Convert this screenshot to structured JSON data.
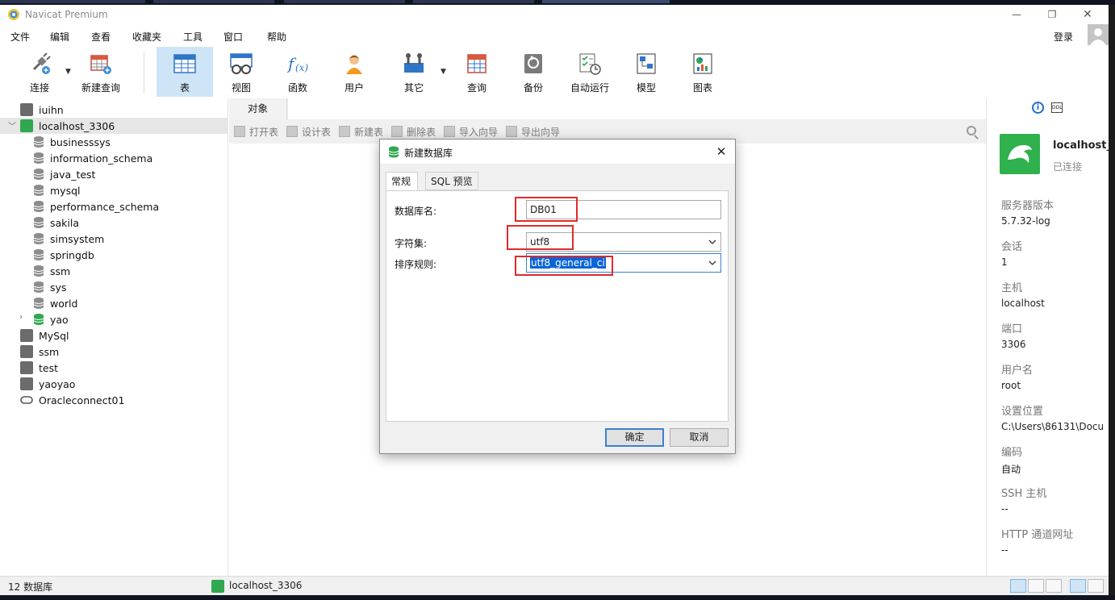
{
  "app": {
    "title": "Navicat Premium"
  },
  "menu": {
    "items": [
      "文件",
      "编辑",
      "查看",
      "收藏夹",
      "工具",
      "窗口",
      "帮助"
    ],
    "login": "登录"
  },
  "toolbar": {
    "items": [
      {
        "label": "连接",
        "icon": "plug-icon"
      },
      {
        "label": "新建查询",
        "icon": "new-query-icon"
      },
      {
        "label": "表",
        "icon": "table-icon"
      },
      {
        "label": "视图",
        "icon": "view-icon"
      },
      {
        "label": "函数",
        "icon": "function-icon"
      },
      {
        "label": "用户",
        "icon": "user-icon"
      },
      {
        "label": "其它",
        "icon": "tools-icon"
      },
      {
        "label": "查询",
        "icon": "query-icon"
      },
      {
        "label": "备份",
        "icon": "backup-icon"
      },
      {
        "label": "自动运行",
        "icon": "schedule-icon"
      },
      {
        "label": "模型",
        "icon": "model-icon"
      },
      {
        "label": "图表",
        "icon": "chart-icon"
      }
    ]
  },
  "tree": {
    "items": [
      {
        "label": "iuihn",
        "type": "connection"
      },
      {
        "label": "localhost_3306",
        "type": "connection-open"
      },
      {
        "label": "businesssys",
        "type": "database"
      },
      {
        "label": "information_schema",
        "type": "database"
      },
      {
        "label": "java_test",
        "type": "database"
      },
      {
        "label": "mysql",
        "type": "database"
      },
      {
        "label": "performance_schema",
        "type": "database"
      },
      {
        "label": "sakila",
        "type": "database"
      },
      {
        "label": "simsystem",
        "type": "database"
      },
      {
        "label": "springdb",
        "type": "database"
      },
      {
        "label": "ssm",
        "type": "database"
      },
      {
        "label": "sys",
        "type": "database"
      },
      {
        "label": "world",
        "type": "database"
      },
      {
        "label": "yao",
        "type": "database-open"
      },
      {
        "label": "MySql",
        "type": "connection"
      },
      {
        "label": "ssm",
        "type": "connection"
      },
      {
        "label": "test",
        "type": "connection"
      },
      {
        "label": "yaoyao",
        "type": "connection"
      },
      {
        "label": "Oracleconnect01",
        "type": "oracle"
      }
    ]
  },
  "center": {
    "tab": "对象",
    "tools": [
      "打开表",
      "设计表",
      "新建表",
      "删除表",
      "导入向导",
      "导出向导"
    ]
  },
  "right_panel": {
    "conn_name": "localhost_",
    "conn_status": "已连接",
    "props": [
      {
        "key": "服务器版本",
        "value": "5.7.32-log"
      },
      {
        "key": "会话",
        "value": "1"
      },
      {
        "key": "主机",
        "value": "localhost"
      },
      {
        "key": "端口",
        "value": "3306"
      },
      {
        "key": "用户名",
        "value": "root"
      },
      {
        "key": "设置位置",
        "value": "C:\\Users\\86131\\Docu"
      },
      {
        "key": "编码",
        "value": "自动"
      },
      {
        "key": "SSH 主机",
        "value": "--"
      },
      {
        "key": "HTTP 通道网址",
        "value": "--"
      }
    ]
  },
  "statusbar": {
    "count": "12 数据库",
    "connection": "localhost_3306"
  },
  "dialog": {
    "title": "新建数据库",
    "tabs": [
      "常规",
      "SQL 预览"
    ],
    "fields": {
      "name_label": "数据库名:",
      "name_value": "DB01",
      "charset_label": "字符集:",
      "charset_value": "utf8",
      "collation_label": "排序规则:",
      "collation_value": "utf8_general_ci"
    },
    "ok": "确定",
    "cancel": "取消"
  },
  "colors": {
    "accent": "#cde5f7",
    "mysql_green": "#2fa84f",
    "highlight_red": "#e02a2a",
    "selection_blue": "#0a64d8"
  }
}
